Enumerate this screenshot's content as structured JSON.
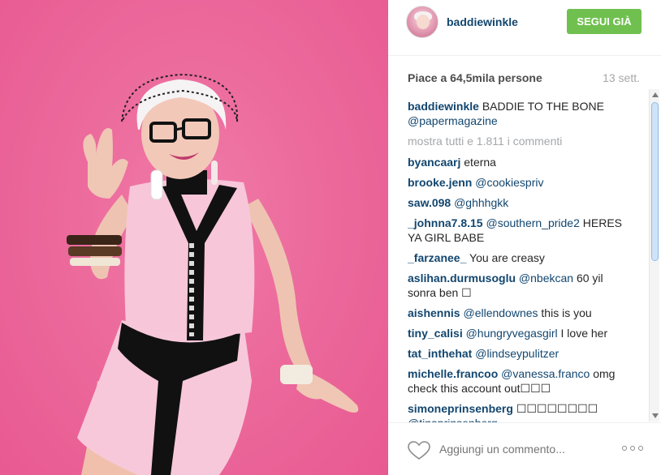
{
  "header": {
    "username": "baddiewinkle",
    "follow_label": "SEGUI GIÀ"
  },
  "post": {
    "likes": "Piace a 64,5mila persone",
    "date": "13 sett."
  },
  "caption": {
    "user": "baddiewinkle",
    "text": "BADDIE TO THE BONE",
    "mention": "@papermagazine"
  },
  "show_all": "mostra tutti e 1.811 i commenti",
  "comments": [
    {
      "user": "byancaarj",
      "mention": "",
      "text": "eterna"
    },
    {
      "user": "brooke.jenn",
      "mention": "@cookiespriv",
      "text": ""
    },
    {
      "user": "saw.098",
      "mention": "@ghhhgkk",
      "text": ""
    },
    {
      "user": "_johnna7.8.15",
      "mention": "@southern_pride2",
      "text": "HERES YA GIRL BABE"
    },
    {
      "user": "_farzanee_",
      "mention": "",
      "text": "You are creasy"
    },
    {
      "user": "aslihan.durmusoglu",
      "mention": "@nbekcan",
      "text": "60 yil sonra ben ☐"
    },
    {
      "user": "aishennis",
      "mention": "@ellendownes",
      "text": "this is you"
    },
    {
      "user": "tiny_calisi",
      "mention": "@hungryvegasgirl",
      "text": "I love her"
    },
    {
      "user": "tat_inthehat",
      "mention": "@lindseypulitzer",
      "text": ""
    },
    {
      "user": "michelle.francoo",
      "mention": "@vanessa.franco",
      "text": "omg check this account out☐☐☐"
    },
    {
      "user": "simoneprinsenberg",
      "mention": "",
      "text": "☐☐☐☐☐☐☐☐"
    },
    {
      "user": "",
      "mention": "@tinaprinsenberg",
      "text": ""
    }
  ],
  "footer": {
    "comment_placeholder": "Aggiungi un commento..."
  },
  "icons": {
    "heart": "heart-icon",
    "more": "more-options-icon"
  },
  "colors": {
    "follow_button": "#70c050",
    "link": "#12466f",
    "background_pink": "#ec6a9c"
  }
}
